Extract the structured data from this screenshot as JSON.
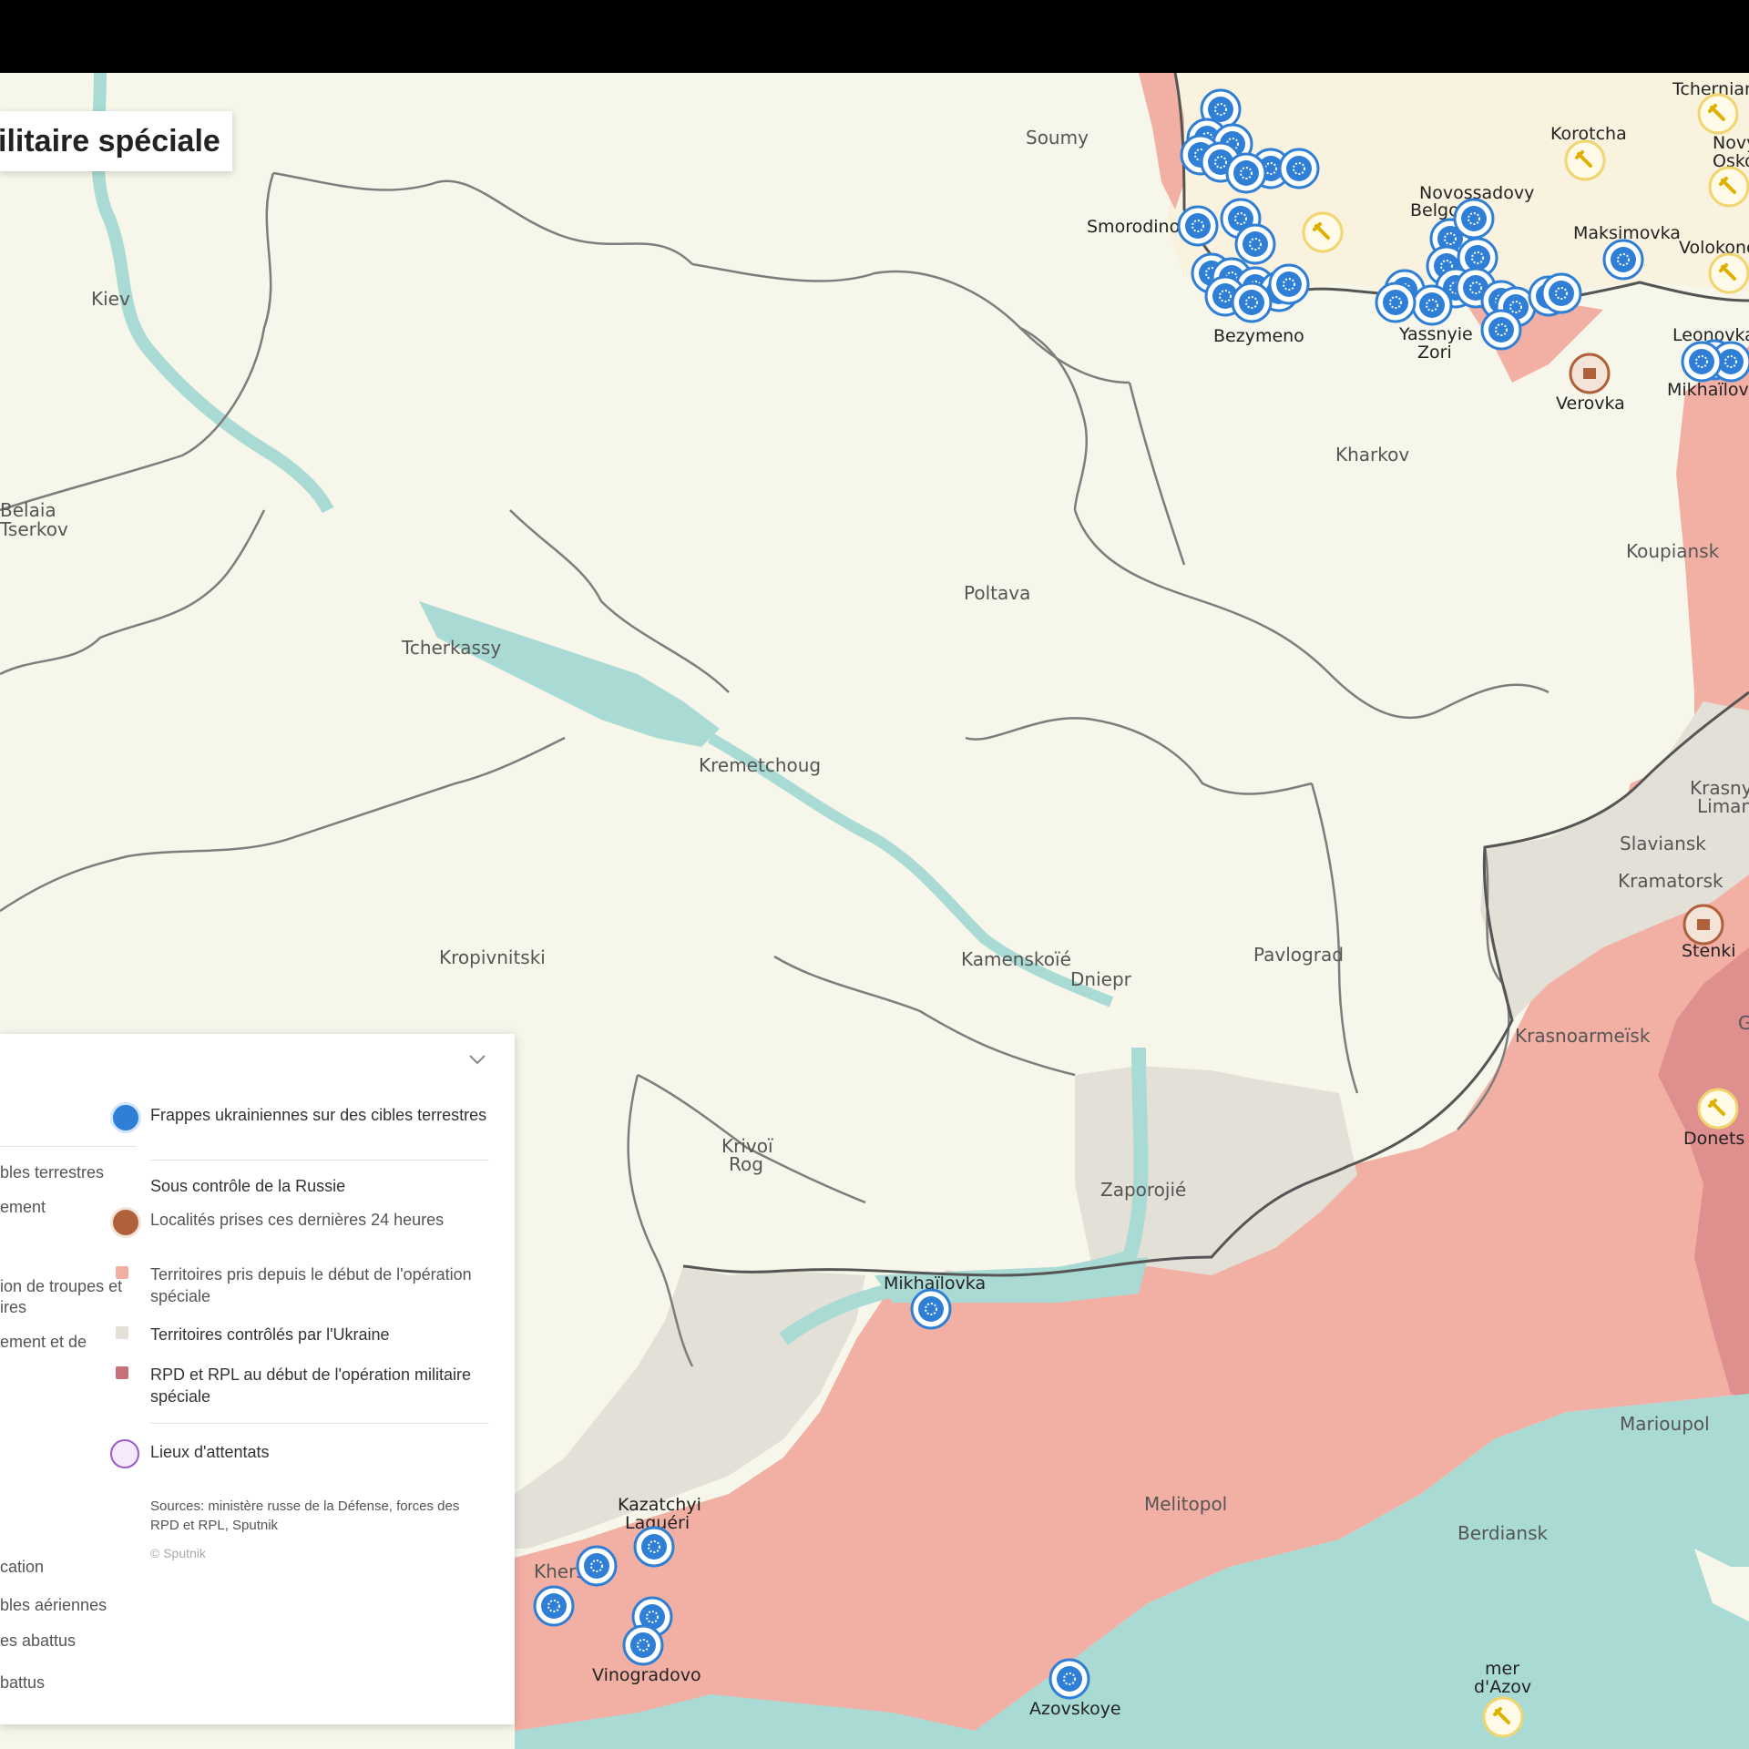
{
  "header": {
    "title": "ilitaire spéciale"
  },
  "colors": {
    "land": "#f6f6ea",
    "russia_land": "#f8f2de",
    "water": "#a9dbd4",
    "taken": "#f2b0a5",
    "ukraine": "#e3e0d8",
    "dpr_lpr": "#e08f8f",
    "strike": "#2f7fd6",
    "arrest": "#f2d56e",
    "captured": "#b0603a"
  },
  "cities": {
    "soumy": "Soumy",
    "kiev": "Kiev",
    "belaia": "Belaia",
    "tserkov": "Tserkov",
    "tcherkassy": "Tcherkassy",
    "poltava": "Poltava",
    "kremetchoug": "Kremetchoug",
    "kropivnitski": "Kropivnitski",
    "kamenskoie": "Kamenskoïé",
    "dniepr": "Dniepr",
    "pavlograd": "Pavlograd",
    "krivoi": "Krivoï",
    "rog": "Rog",
    "zaporojie": "Zaporojié",
    "kharkov": "Kharkov",
    "koupiansk": "Koupiansk",
    "krasny": "Krasny",
    "liman": "Liman",
    "slaviansk": "Slaviansk",
    "kramatorsk": "Kramatorsk",
    "stenki": "Stenki",
    "krasnoarmeisk": "Krasnoarmeïsk",
    "donetsk": "Donets",
    "marioupol": "Marioupol",
    "melitopol": "Melitopol",
    "berdiansk": "Berdiansk",
    "mer": "mer",
    "dazov": "d'Azov",
    "azovskoye": "Azovskoye",
    "vinogradovo": "Vinogradovo",
    "kherson": "Kherson",
    "kazatchyi": "Kazatchyi",
    "laguéri": "Laguéri",
    "mikhailovka_s": "Mikhaïlovka",
    "smorodino": "Smorodino",
    "bezymeno": "Bezymeno",
    "belgorod": "Belgorod",
    "novossadovy": "Novossadovy",
    "yasnyie": "Yassnyie",
    "zori": "Zori",
    "verovka": "Verovka",
    "maksimovka": "Maksimovka",
    "korotcha": "Korotcha",
    "tcherniank": "Tcherniank",
    "novy": "Novy",
    "oskol": "Osko",
    "volokonovka": "Volokonov",
    "leonovka": "Leonovka",
    "mikhailovka_n": "Mikhaïlovk",
    "g": "G"
  },
  "legend": {
    "left_lines": [
      "bles terrestres",
      "ement",
      "ion de troupes et",
      "ires",
      "ement et de",
      "cation",
      "bles aériennes",
      "es abattus",
      "battus"
    ],
    "strikes": "Frappes ukrainiennes sur des cibles terrestres",
    "section_title": "Sous contrôle de la Russie",
    "captured_24h": "Localités prises ces dernières 24 heures",
    "territories_taken": "Territoires pris depuis le début de l'opération spéciale",
    "ukraine_controlled": "Territoires contrôlés par l'Ukraine",
    "dpr_lpr": "RPD et RPL au début de l'opération militaire spéciale",
    "attacks": "Lieux d'attentats",
    "sources": "Sources: ministère russe de la Défense, forces des RPD et RPL, Sputnik",
    "copyright": "© Sputnik"
  },
  "markers": {
    "strikes": [
      [
        1340,
        120
      ],
      [
        1325,
        152
      ],
      [
        1353,
        158
      ],
      [
        1318,
        170
      ],
      [
        1340,
        178
      ],
      [
        1395,
        185
      ],
      [
        1426,
        185
      ],
      [
        1368,
        190
      ],
      [
        1315,
        248
      ],
      [
        1362,
        240
      ],
      [
        1378,
        268
      ],
      [
        1330,
        300
      ],
      [
        1352,
        305
      ],
      [
        1378,
        315
      ],
      [
        1345,
        325
      ],
      [
        1404,
        320
      ],
      [
        1415,
        312
      ],
      [
        1374,
        332
      ],
      [
        1592,
        262
      ],
      [
        1618,
        240
      ],
      [
        1588,
        292
      ],
      [
        1622,
        283
      ],
      [
        1598,
        316
      ],
      [
        1620,
        316
      ],
      [
        1542,
        318
      ],
      [
        1572,
        335
      ],
      [
        1532,
        332
      ],
      [
        1648,
        330
      ],
      [
        1664,
        337
      ],
      [
        1700,
        325
      ],
      [
        1714,
        322
      ],
      [
        1648,
        362
      ],
      [
        1782,
        285
      ],
      [
        1882,
        395
      ],
      [
        1900,
        397
      ],
      [
        1868,
        397
      ],
      [
        1022,
        1437
      ],
      [
        655,
        1719
      ],
      [
        718,
        1698
      ],
      [
        608,
        1763
      ],
      [
        716,
        1775
      ],
      [
        706,
        1806
      ],
      [
        1174,
        1843
      ]
    ],
    "arrests": [
      [
        1452,
        255
      ],
      [
        1740,
        176
      ],
      [
        1886,
        125
      ],
      [
        1898,
        205
      ],
      [
        1898,
        300
      ],
      [
        1886,
        1217
      ],
      [
        1650,
        1885
      ]
    ],
    "captured": [
      [
        1745,
        410
      ],
      [
        1870,
        1015
      ]
    ]
  }
}
